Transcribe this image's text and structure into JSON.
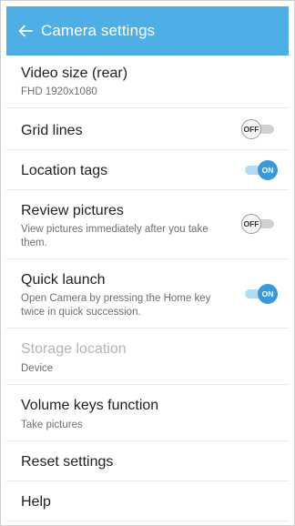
{
  "header": {
    "title": "Camera settings"
  },
  "settings": [
    {
      "label": "Video size (rear)",
      "sub": "FHD 1920x1080"
    },
    {
      "label": "Grid lines",
      "toggle": "OFF"
    },
    {
      "label": "Location tags",
      "toggle": "ON"
    },
    {
      "label": "Review pictures",
      "sub": "View pictures immediately after you take them.",
      "toggle": "OFF"
    },
    {
      "label": "Quick launch",
      "sub": "Open Camera by pressing the Home key twice in quick succession.",
      "toggle": "ON"
    },
    {
      "label": "Storage location",
      "sub": "Device"
    },
    {
      "label": "Volume keys function",
      "sub": "Take pictures"
    },
    {
      "label": "Reset settings"
    },
    {
      "label": "Help"
    }
  ],
  "colors": {
    "accent": "#4eaee6",
    "toggle_on": "#3a9ad9"
  }
}
